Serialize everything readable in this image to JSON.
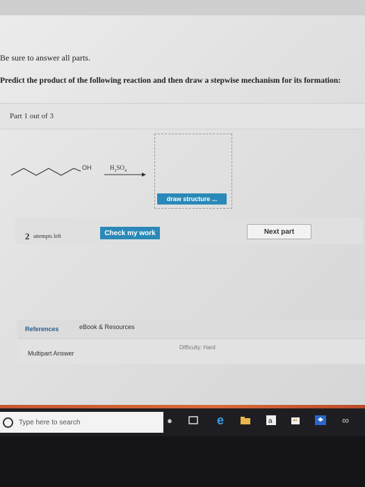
{
  "instruction": "Be sure to answer all parts.",
  "question": "Predict the product of the following reaction and then draw a stepwise mechanism for its formation:",
  "part_label": "Part 1 out of 3",
  "reaction": {
    "group": "OH",
    "reagent_main": "H",
    "reagent_sub1": "2",
    "reagent_mid": "SO",
    "reagent_sub2": "4"
  },
  "draw_button": "draw structure ...",
  "attempts": {
    "count": "2",
    "text": "attempts left"
  },
  "check_button": "Check my work",
  "next_button": "Next part",
  "references_tab": "References",
  "ebook_tab": "eBook & Resources",
  "multipart_label": "Multipart Answer",
  "difficulty": "Difficulty: Hard",
  "taskbar": {
    "search_placeholder": "Type here to search",
    "icons": [
      "cortana-icon",
      "task-view-icon",
      "edge-icon",
      "file-explorer-icon",
      "store-icon",
      "dropbox-icon"
    ]
  }
}
